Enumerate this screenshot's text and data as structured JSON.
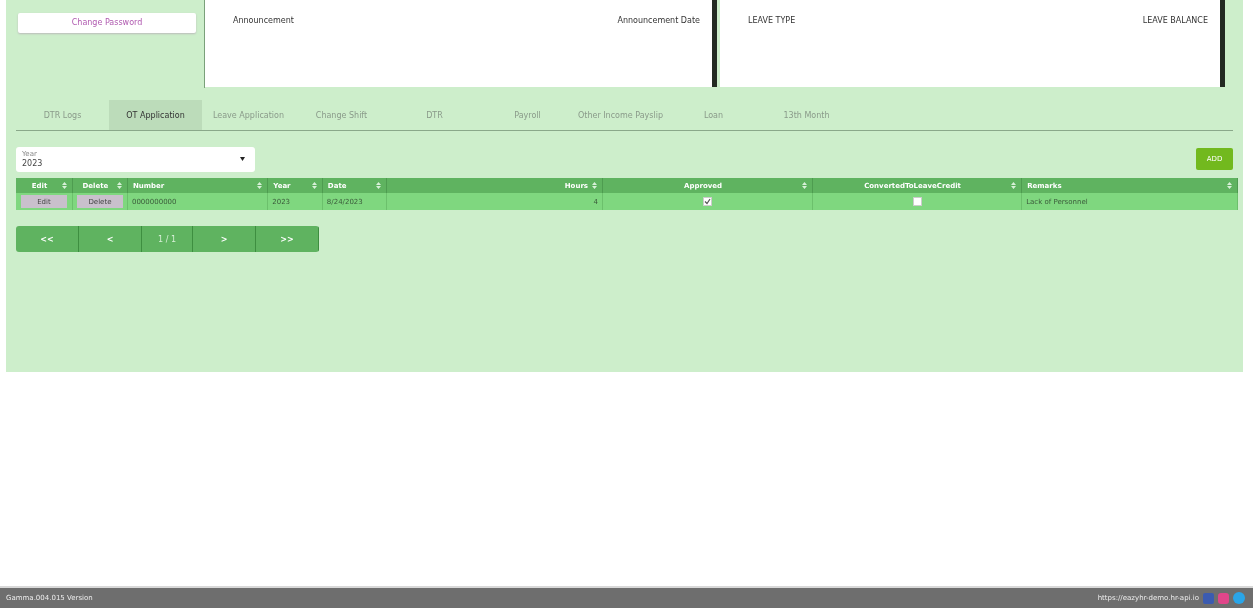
{
  "sidebar": {
    "change_password_button": "Change Password"
  },
  "announcements": {
    "columns": [
      "Announcement",
      "Announcement Date"
    ]
  },
  "leave_balances": {
    "columns": [
      "LEAVE TYPE",
      "LEAVE BALANCE"
    ]
  },
  "tabs": [
    {
      "label": "DTR Logs",
      "selected": false
    },
    {
      "label": "OT Application",
      "selected": true
    },
    {
      "label": "Leave Application",
      "selected": false
    },
    {
      "label": "Change Shift",
      "selected": false
    },
    {
      "label": "DTR",
      "selected": false
    },
    {
      "label": "Payroll",
      "selected": false
    },
    {
      "label": "Other Income Payslip",
      "selected": false
    },
    {
      "label": "Loan",
      "selected": false
    },
    {
      "label": "13th Month",
      "selected": false
    }
  ],
  "year_filter": {
    "label": "Year",
    "value": "2023"
  },
  "add_button": "ADD",
  "table": {
    "columns": [
      {
        "label": "Edit"
      },
      {
        "label": "Delete"
      },
      {
        "label": "Number"
      },
      {
        "label": "Year"
      },
      {
        "label": "Date"
      },
      {
        "label": "Hours"
      },
      {
        "label": "Approved"
      },
      {
        "label": "ConvertedToLeaveCredit"
      },
      {
        "label": "Remarks"
      }
    ],
    "rows": [
      {
        "edit": "Edit",
        "delete": "Delete",
        "number": "0000000000",
        "year": "2023",
        "date": "8/24/2023",
        "hours": "4",
        "approved": true,
        "converted_to_leave_credit": false,
        "remarks": "Lack of Personnel"
      }
    ]
  },
  "pagination": {
    "first": "<<",
    "previous": "<",
    "page": "1 / 1",
    "next": ">",
    "last": ">>"
  },
  "footer": {
    "version": "Gamma.004.015 Version",
    "url": "https://eazyhr-demo.hr-api.io"
  }
}
